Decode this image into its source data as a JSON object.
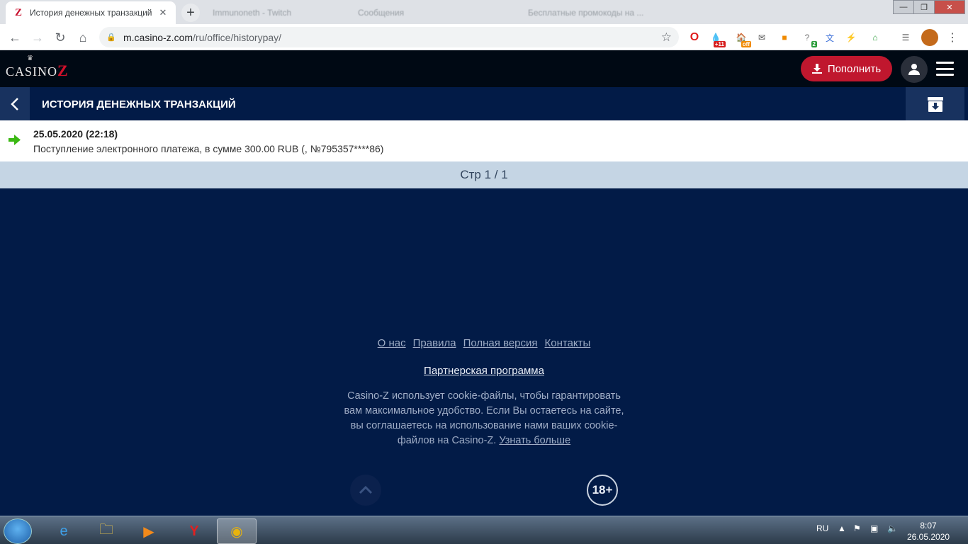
{
  "browser": {
    "active_tab_title": "История денежных транзакций",
    "tab_favicon_letter": "Z",
    "background_tabs": [
      "Immunoneth - Twitch",
      "Сообщения",
      "Бесплатные промокоды на ..."
    ],
    "url_host": "m.casino-z.com",
    "url_path": "/ru/office/historypay/",
    "extension_badges": {
      "red": "+11",
      "orange": "off",
      "green": "2"
    }
  },
  "site": {
    "logo_text": "CASINO",
    "logo_z": "Z",
    "deposit_label": "Пополнить"
  },
  "page": {
    "title": "ИСТОРИЯ ДЕНЕЖНЫХ ТРАНЗАКЦИЙ",
    "transactions": [
      {
        "date": "25.05.2020 (22:18)",
        "description": "Поступление электронного платежа, в сумме 300.00 RUB (, №795357****86)"
      }
    ],
    "pager": "Стр 1 / 1"
  },
  "footer": {
    "links": [
      "О нас",
      "Правила",
      "Полная версия",
      "Контакты"
    ],
    "partner_link": "Партнерская программа",
    "cookie_text": "Casino-Z использует cookie-файлы, чтобы гарантировать вам максимальное удобство. Если Вы остаетесь на сайте, вы соглашаетесь на использование нами ваших cookie-файлов на Casino-Z.",
    "learn_more": "Узнать больше",
    "age_label": "18+"
  },
  "taskbar": {
    "language": "RU",
    "time": "8:07",
    "date": "26.05.2020"
  },
  "colors": {
    "accent_red": "#c0172e",
    "page_bg": "#021b47",
    "pager_bg": "#c5d5e4",
    "income_arrow": "#3cb814"
  }
}
